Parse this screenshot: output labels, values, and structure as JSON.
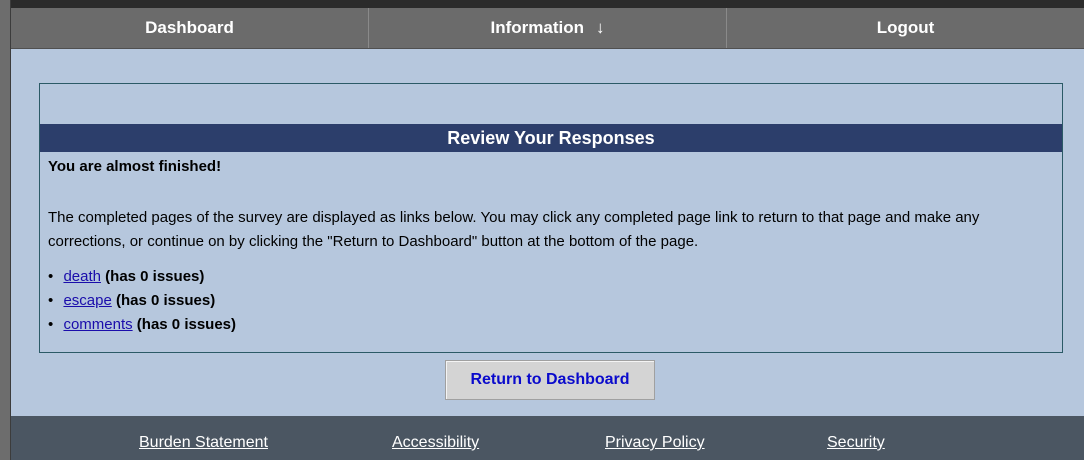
{
  "nav": {
    "items": [
      {
        "label": "Dashboard"
      },
      {
        "label": "Information",
        "arrow": "↓"
      },
      {
        "label": "Logout"
      }
    ]
  },
  "panel": {
    "header": "Review Your Responses",
    "almost_finished": "You are almost finished!",
    "description": "The completed pages of the survey are displayed as links below. You may click any completed page link to return to that page and make any corrections, or continue on by clicking the \"Return to Dashboard\" button at the bottom of the page.",
    "pages": [
      {
        "link": "death",
        "issues": "(has 0 issues)"
      },
      {
        "link": "escape",
        "issues": "(has 0 issues)"
      },
      {
        "link": "comments",
        "issues": "(has 0 issues)"
      }
    ]
  },
  "button": {
    "return_label": "Return to Dashboard"
  },
  "footer": {
    "links": [
      "Burden Statement",
      "Accessibility",
      "Privacy Policy",
      "Security"
    ]
  },
  "colors": {
    "nav_bg": "#6b6b6b",
    "content_bg": "#b6c7dd",
    "header_bg": "#2c3e6b",
    "footer_bg": "#4b5662",
    "link": "#1a0dab",
    "button_text": "#0a0acc"
  }
}
